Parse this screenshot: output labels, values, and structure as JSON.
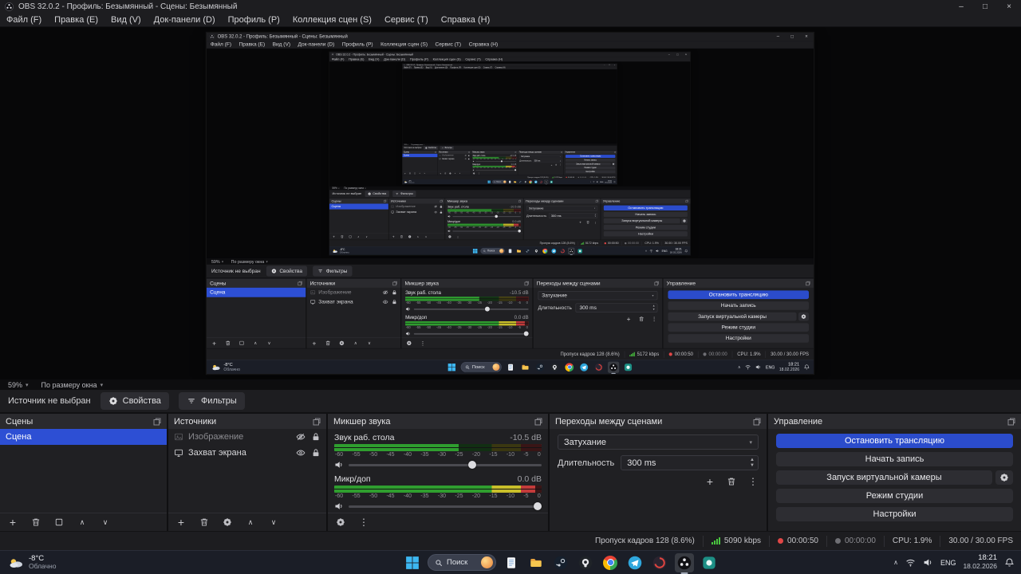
{
  "window": {
    "title": "OBS 32.0.2 - Профиль: Безымянный - Сцены: Безымянный"
  },
  "menu": {
    "items": [
      "Файл (F)",
      "Правка (E)",
      "Вид (V)",
      "Док-панели (D)",
      "Профиль (P)",
      "Коллекция сцен (S)",
      "Сервис (T)",
      "Справка (H)"
    ]
  },
  "preview": {
    "zoom": "59%",
    "fit": "По размеру окна"
  },
  "source_toolbar": {
    "no_source_label": "Источник не выбран",
    "properties": "Свойства",
    "filters": "Фильтры"
  },
  "docks": {
    "scenes": {
      "title": "Сцены",
      "items": [
        {
          "name": "Сцена",
          "selected": true
        }
      ]
    },
    "sources": {
      "title": "Источники",
      "items": [
        {
          "name": "Изображение",
          "type": "image",
          "visible": false,
          "locked": true
        },
        {
          "name": "Захват экрана",
          "type": "display-capture",
          "visible": true,
          "locked": true
        }
      ]
    },
    "mixer": {
      "title": "Микшер звука",
      "channels": [
        {
          "name": "Звук раб. стола",
          "db": "-10.5 dB",
          "meter_pct": 60,
          "slider_pct": 64
        },
        {
          "name": "Микр/доп",
          "db": "0.0 dB",
          "meter_pct": 97,
          "slider_pct": 98
        }
      ],
      "scale": [
        "-60",
        "-55",
        "-50",
        "-45",
        "-40",
        "-35",
        "-30",
        "-25",
        "-20",
        "-15",
        "-10",
        "-5",
        "0"
      ]
    },
    "transitions": {
      "title": "Переходы между сценами",
      "transition": "Затухание",
      "duration_label": "Длительность",
      "duration_value": "300 ms"
    },
    "controls": {
      "title": "Управление",
      "stop_stream": "Остановить трансляцию",
      "start_record": "Начать запись",
      "virtual_camera": "Запуск виртуальной камеры",
      "studio_mode": "Режим студии",
      "settings": "Настройки"
    }
  },
  "status": {
    "dropped_frames": "Пропуск кадров 128 (8.6%)",
    "bitrate": "5090 kbps",
    "bitrate_inner": "5172 kbps",
    "stream_time": "00:00:50",
    "record_time": "00:00:00",
    "cpu": "CPU: 1.9%",
    "fps": "30.00 / 30.00 FPS"
  },
  "taskbar": {
    "weather_temp": "-8°C",
    "weather_desc": "Облачно",
    "search_placeholder": "Поиск",
    "language": "ENG",
    "time": "18:21",
    "date": "18.02.2026"
  },
  "icons": {
    "minimize": "–",
    "maximize": "□",
    "close": "×",
    "caret_down": "▾",
    "chevron_up": "∧",
    "chevron_down": "∨",
    "dots_vertical": "⋮",
    "plus": "+",
    "spin_up": "▲",
    "spin_down": "▼",
    "tray_chevron": "∧"
  },
  "colors": {
    "accent_blue": "#2d4fd4",
    "meter_green": "#2f9e2f",
    "meter_yellow": "#c9bf2a",
    "meter_red": "#c43b3b",
    "record_red": "#e14747",
    "signal_green": "#49c53f"
  }
}
